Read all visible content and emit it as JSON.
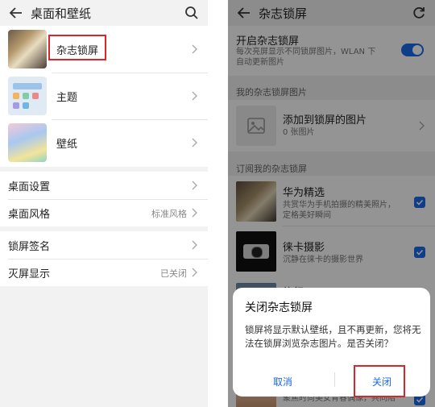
{
  "left": {
    "title": "桌面和壁纸",
    "items": [
      {
        "label": "杂志锁屏"
      },
      {
        "label": "主题"
      },
      {
        "label": "壁纸"
      }
    ],
    "settings": [
      {
        "label": "桌面设置",
        "value": ""
      },
      {
        "label": "桌面风格",
        "value": "标准风格"
      },
      {
        "label": "锁屏签名",
        "value": ""
      },
      {
        "label": "灭屏显示",
        "value": "已关闭"
      }
    ]
  },
  "right": {
    "title": "杂志锁屏",
    "toggle": {
      "label": "开启杂志锁屏",
      "description_line1": "每次亮屏显示不同锁屏图片，WLAN 下",
      "description_line2": "自动更新图片",
      "on": true
    },
    "my_images_header": "我的杂志锁屏图片",
    "add_images": {
      "title": "添加到锁屏的图片",
      "count": "0 张图片"
    },
    "subscriptions_header": "订阅我的杂志锁屏",
    "subscriptions": [
      {
        "title": "华为精选",
        "desc_line1": "共赏华为手机拍摄的精美照片，",
        "desc_line2": "定格美好瞬间",
        "checked": true
      },
      {
        "title": "徕卡摄影",
        "desc_line1": "沉静在徕卡的摄影世界",
        "desc_line2": "",
        "checked": true
      },
      {
        "title": "旅行",
        "desc_line1": "",
        "desc_line2": "",
        "checked": true
      },
      {
        "title": "",
        "desc_line1": "聚焦时尚美女青春偶像，共同陪",
        "desc_line2": "",
        "checked": true
      }
    ],
    "dialog": {
      "title": "关闭杂志锁屏",
      "message": "锁屏将显示默认壁纸，且不再更新，您将无法在锁屏浏览杂志图片。是否关闭？",
      "cancel": "取消",
      "confirm": "关闭"
    }
  },
  "colors": {
    "accent": "#1a6ae8",
    "highlight": "#d8262b"
  },
  "icons": [
    "back-arrow-icon",
    "search-icon",
    "refresh-icon",
    "chevron-right-icon",
    "image-placeholder-icon",
    "checkmark-icon"
  ]
}
